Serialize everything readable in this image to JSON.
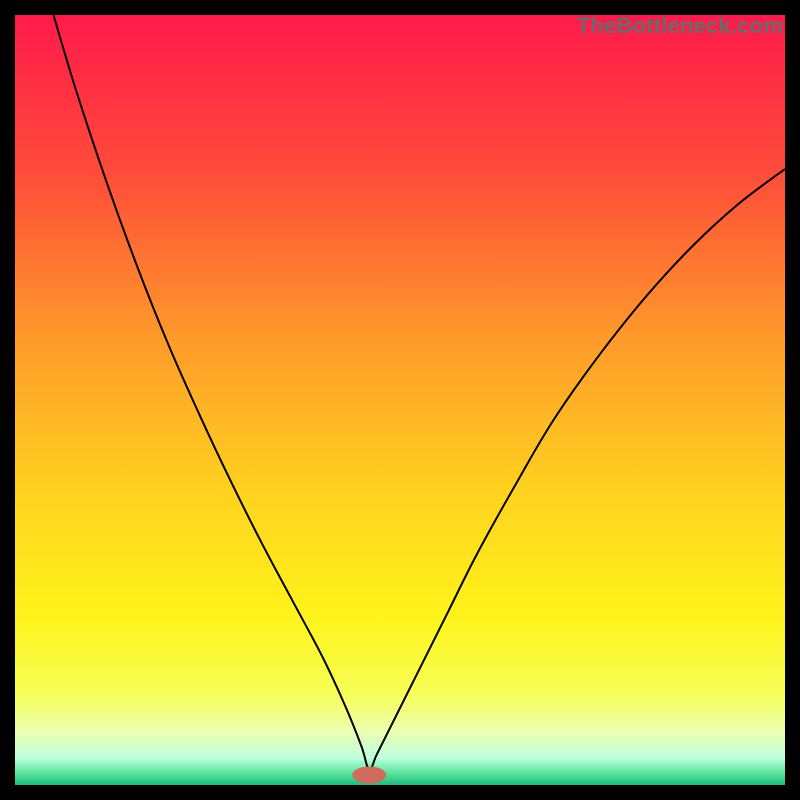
{
  "watermark": "TheBottleneck.com",
  "chart_data": {
    "type": "line",
    "title": "",
    "xlabel": "",
    "ylabel": "",
    "xlim": [
      0,
      100
    ],
    "ylim": [
      0,
      100
    ],
    "grid": false,
    "legend": false,
    "annotations": [],
    "background_gradient_stops": [
      {
        "pos": 0.0,
        "color": "#ff1a4b"
      },
      {
        "pos": 0.2,
        "color": "#ff4a3a"
      },
      {
        "pos": 0.42,
        "color": "#ff9a2a"
      },
      {
        "pos": 0.62,
        "color": "#ffd21f"
      },
      {
        "pos": 0.78,
        "color": "#fff31a"
      },
      {
        "pos": 0.88,
        "color": "#f6ff55"
      },
      {
        "pos": 0.93,
        "color": "#ecffb0"
      },
      {
        "pos": 0.965,
        "color": "#bfffe0"
      },
      {
        "pos": 0.985,
        "color": "#57e39a"
      },
      {
        "pos": 1.0,
        "color": "#1dba7e"
      }
    ],
    "marker": {
      "x": 46,
      "y": 1.3,
      "rx": 2.2,
      "ry": 1.1,
      "color": "#d06a5a"
    },
    "series": [
      {
        "name": "curve",
        "color": "#000000",
        "stroke_width": 2,
        "x": [
          5,
          8,
          12,
          16,
          20,
          24,
          28,
          32,
          36,
          40,
          43,
          45,
          46,
          47,
          49,
          52,
          56,
          60,
          65,
          70,
          76,
          82,
          88,
          94,
          100
        ],
        "y": [
          100,
          90,
          78,
          67,
          57,
          48,
          39.5,
          31.5,
          24,
          16.5,
          10,
          5,
          2,
          4,
          8,
          14,
          22,
          30,
          39,
          47.5,
          56,
          63.5,
          70,
          75.5,
          80
        ]
      }
    ]
  }
}
